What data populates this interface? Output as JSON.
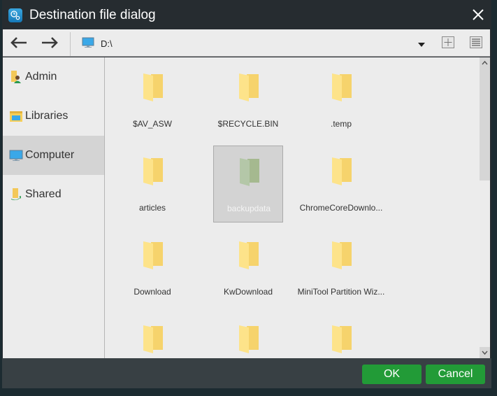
{
  "window": {
    "title": "Destination file dialog",
    "icon": "app-backup-icon"
  },
  "toolbar": {
    "back_icon": "arrow-left-icon",
    "forward_icon": "arrow-right-icon",
    "path_icon": "computer-icon",
    "path": "D:\\",
    "dropdown_icon": "triangle-down-icon",
    "new_folder_icon": "plus-icon",
    "view_icon": "list-view-icon"
  },
  "sidebar": {
    "items": [
      {
        "label": "Admin",
        "icon": "user-folder-icon",
        "active": false
      },
      {
        "label": "Libraries",
        "icon": "libraries-icon",
        "active": false
      },
      {
        "label": "Computer",
        "icon": "computer-icon",
        "active": true
      },
      {
        "label": "Shared",
        "icon": "shared-folder-icon",
        "active": false
      }
    ]
  },
  "files": [
    {
      "name": "$AV_ASW",
      "selected": false
    },
    {
      "name": "$RECYCLE.BIN",
      "selected": false
    },
    {
      "name": ".temp",
      "selected": false
    },
    {
      "name": "articles",
      "selected": false
    },
    {
      "name": "backupdata",
      "selected": true
    },
    {
      "name": "ChromeCoreDownlo...",
      "selected": false
    },
    {
      "name": "Download",
      "selected": false
    },
    {
      "name": "KwDownload",
      "selected": false
    },
    {
      "name": "MiniTool Partition Wiz...",
      "selected": false
    },
    {
      "name": "",
      "selected": false
    },
    {
      "name": "",
      "selected": false
    },
    {
      "name": "",
      "selected": false
    }
  ],
  "footer": {
    "ok_label": "OK",
    "cancel_label": "Cancel"
  },
  "colors": {
    "accent_green": "#229b37",
    "titlebar": "#262c30",
    "footer": "#384044",
    "folder_yellow": "#f9d974"
  }
}
